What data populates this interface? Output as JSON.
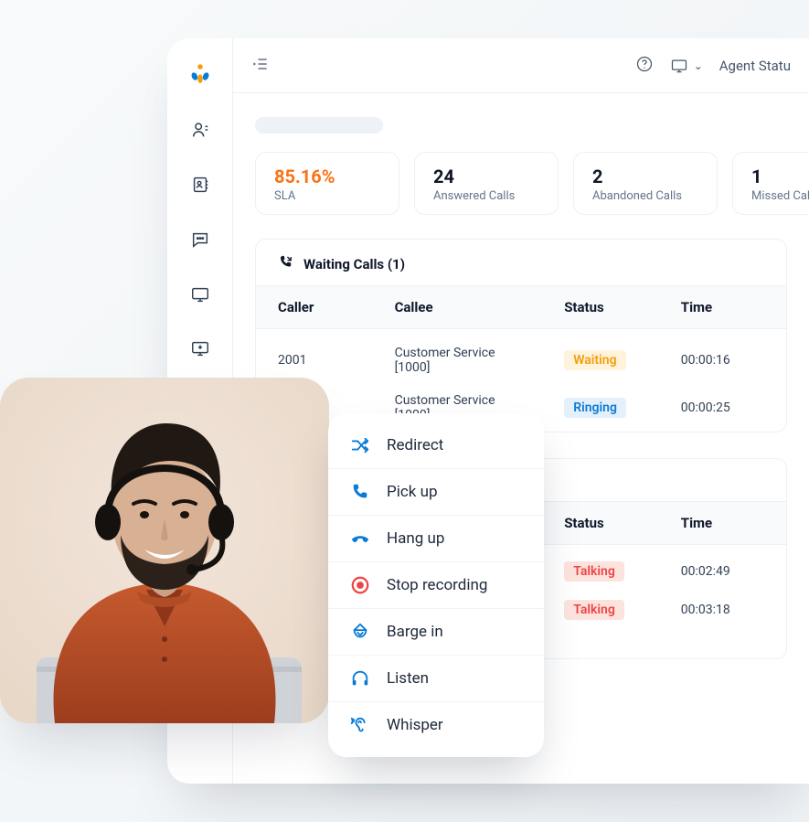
{
  "topbar": {
    "status_label": "Agent Statu"
  },
  "stats": {
    "sla": {
      "value": "85.16%",
      "label": "SLA"
    },
    "answered": {
      "value": "24",
      "label": "Answered Calls"
    },
    "abandoned": {
      "value": "2",
      "label": "Abandoned Calls"
    },
    "missed": {
      "value": "1",
      "label": "Missed Calls"
    }
  },
  "waiting": {
    "title": "Waiting Calls (1)",
    "columns": {
      "caller": "Caller",
      "callee": "Callee",
      "status": "Status",
      "time": "Time"
    },
    "rows": [
      {
        "caller": "2001",
        "callee": "Customer Service [1000]",
        "status": "Waiting",
        "status_class": "waiting",
        "time": "00:00:16"
      },
      {
        "caller": "",
        "callee": "Customer Service [1000]",
        "status": "Ringing",
        "status_class": "ringing",
        "time": "00:00:25"
      }
    ]
  },
  "active": {
    "columns": {
      "status": "Status",
      "time": "Time"
    },
    "rows": [
      {
        "status": "Talking",
        "status_class": "talking",
        "time": "00:02:49"
      },
      {
        "status": "Talking",
        "status_class": "talking",
        "time": "00:03:18"
      }
    ]
  },
  "ctx": {
    "items": [
      {
        "key": "redirect",
        "label": "Redirect"
      },
      {
        "key": "pickup",
        "label": "Pick up"
      },
      {
        "key": "hangup",
        "label": "Hang up"
      },
      {
        "key": "stoprec",
        "label": "Stop recording"
      },
      {
        "key": "bargein",
        "label": "Barge in"
      },
      {
        "key": "listen",
        "label": "Listen"
      },
      {
        "key": "whisper",
        "label": "Whisper"
      }
    ]
  }
}
